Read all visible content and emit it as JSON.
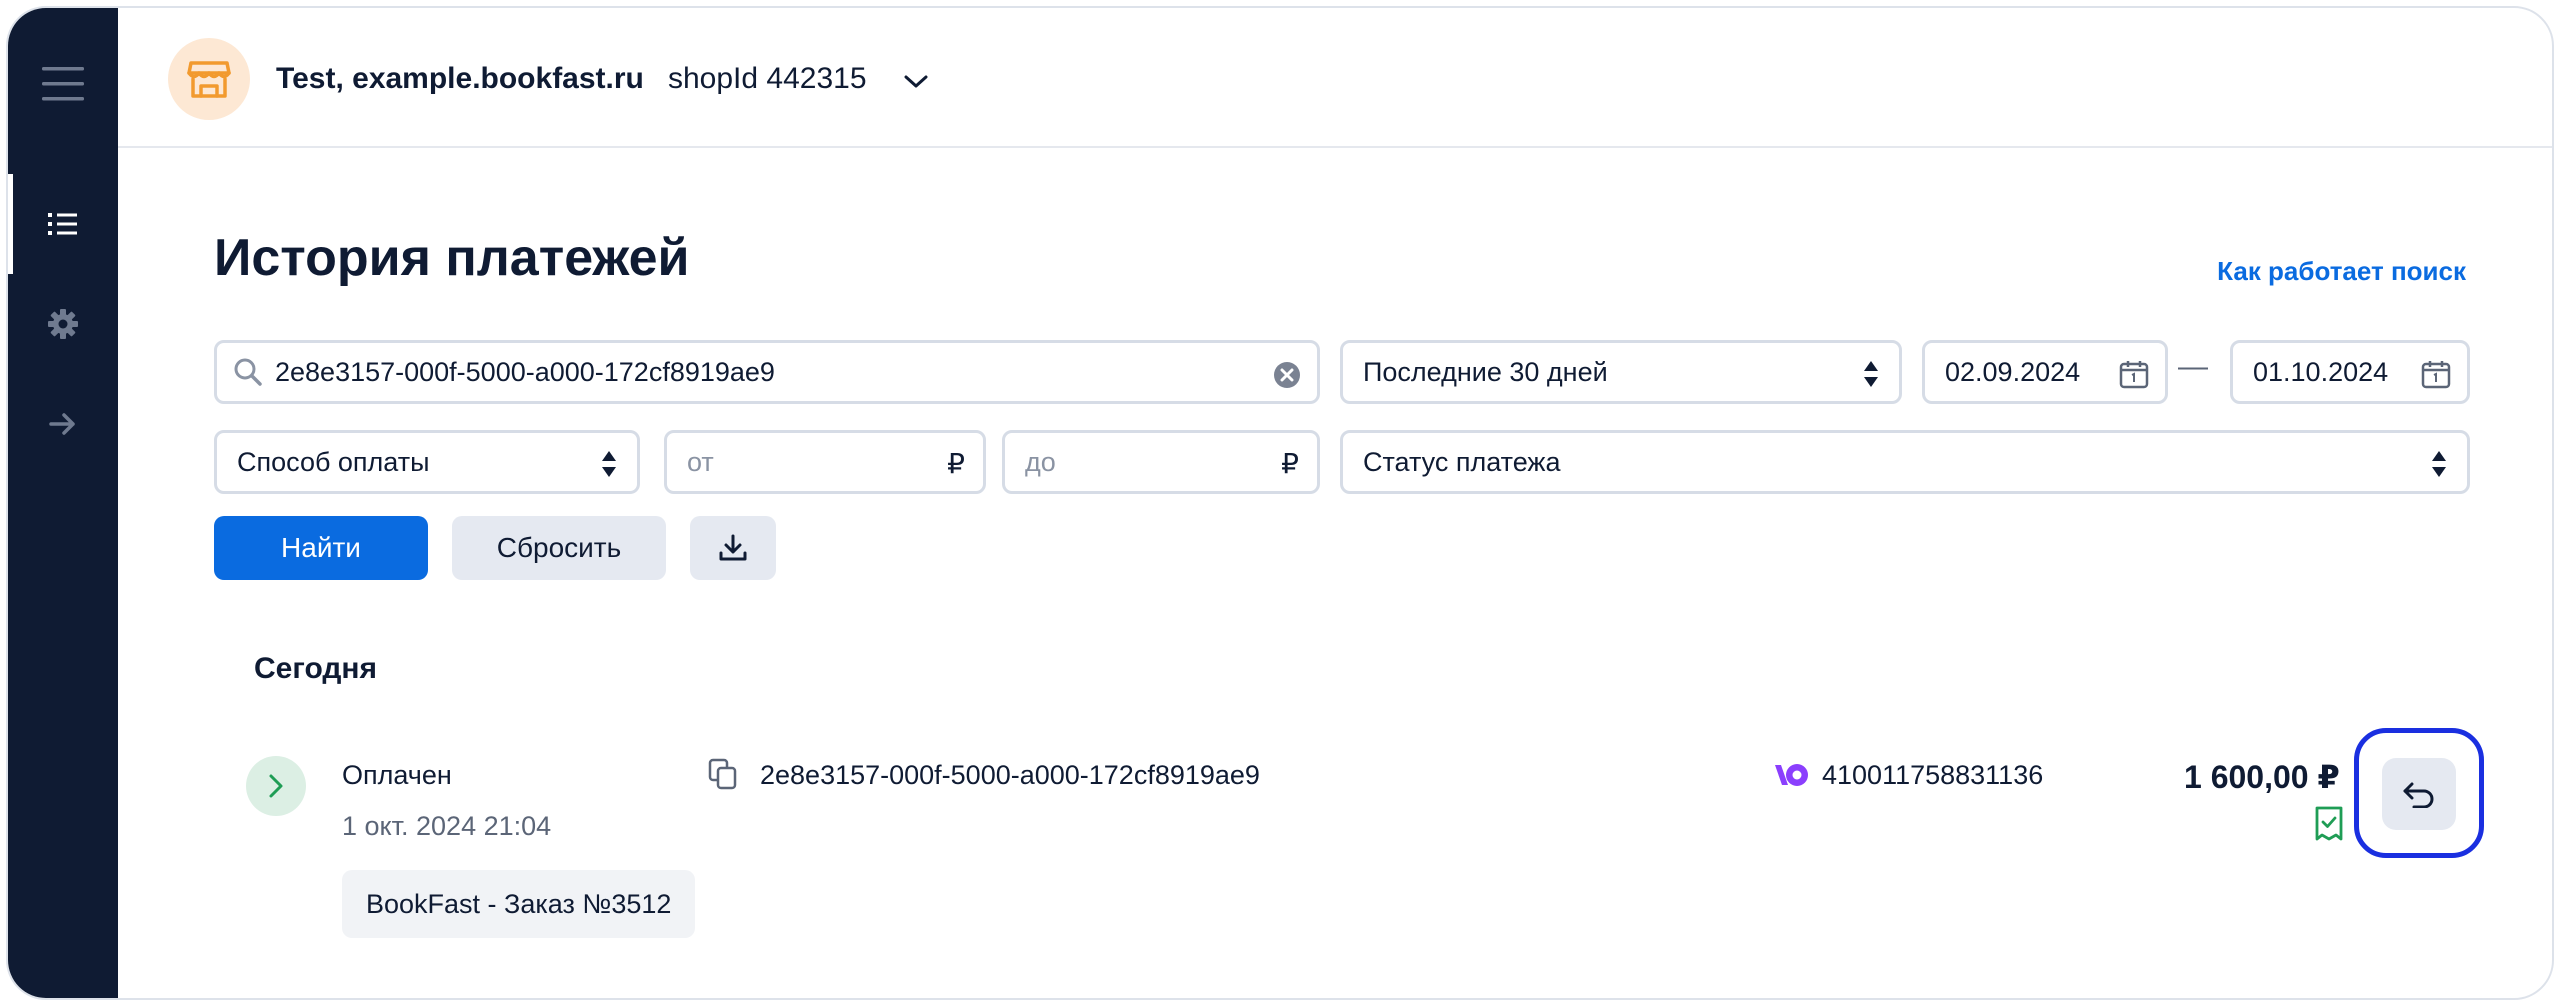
{
  "shop": {
    "name": "Test, example.bookfast.ru",
    "id": "shopId 442315"
  },
  "page": {
    "title": "История платежей",
    "help_link": "Как работает поиск"
  },
  "filters": {
    "search_value": "2e8e3157-000f-5000-a000-172cf8919ae9",
    "period": "Последние 30 дней",
    "date_from": "02.09.2024",
    "date_separator": "—",
    "date_to": "01.10.2024",
    "payment_method": "Способ оплаты",
    "amount_from_placeholder": "от",
    "amount_to_placeholder": "до",
    "currency": "₽",
    "payment_status": "Статус платежа"
  },
  "actions": {
    "find": "Найти",
    "reset": "Сбросить"
  },
  "group": {
    "label": "Сегодня"
  },
  "payment": {
    "status": "Оплачен",
    "datetime": "1 окт. 2024 21:04",
    "id": "2e8e3157-000f-5000-a000-172cf8919ae9",
    "wallet": "410011758831136",
    "amount": "1 600,00 ₽",
    "description": "BookFast - Заказ №3512"
  },
  "colors": {
    "sidebar": "#0f1b33",
    "accent": "#0a6be0",
    "shop_icon": "#f29a2e",
    "success": "#1f9d55",
    "wallet_brand": "#8b3ffd",
    "highlight": "#1a2fe0"
  },
  "icons": {
    "sidebar": [
      "menu-icon",
      "list-icon",
      "gear-icon",
      "arrow-right-icon"
    ],
    "header": [
      "store-icon",
      "chevron-down-icon"
    ],
    "search": [
      "search-icon",
      "clear-icon"
    ],
    "row": [
      "chevron-right-icon",
      "copy-icon",
      "yoomoney-icon",
      "receipt-icon",
      "refund-icon"
    ],
    "toolbar": [
      "download-icon"
    ],
    "date": [
      "calendar-icon"
    ]
  }
}
